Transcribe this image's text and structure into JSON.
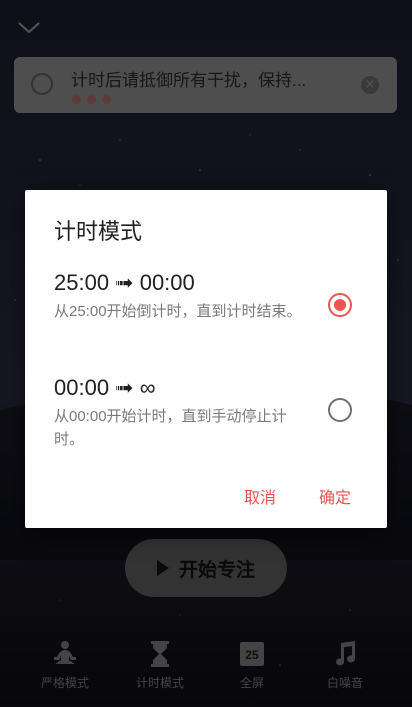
{
  "task": {
    "text": "计时后请抵御所有干扰，保持...",
    "pomodoro_count": 3
  },
  "start_button": {
    "label": "开始专注"
  },
  "bottom_nav": [
    {
      "label": "严格模式",
      "icon": "meditation-icon"
    },
    {
      "label": "计时模式",
      "icon": "hourglass-icon"
    },
    {
      "label": "全屏",
      "icon": "calendar-25-icon",
      "icon_text": "25"
    },
    {
      "label": "白噪音",
      "icon": "music-note-icon"
    }
  ],
  "dialog": {
    "title": "计时模式",
    "options": [
      {
        "head": "25:00 ➟ 00:00",
        "desc": "从25:00开始倒计时，直到计时结束。",
        "selected": true
      },
      {
        "head": "00:00 ➟ ∞",
        "desc": "从00:00开始计时，直到手动停止计时。",
        "selected": false
      }
    ],
    "cancel": "取消",
    "confirm": "确定"
  },
  "colors": {
    "accent": "#ef5350",
    "dialog_bg": "#ffffff",
    "card_bg": "#8f8f8f",
    "nav_icon": "#7d7d7d"
  }
}
